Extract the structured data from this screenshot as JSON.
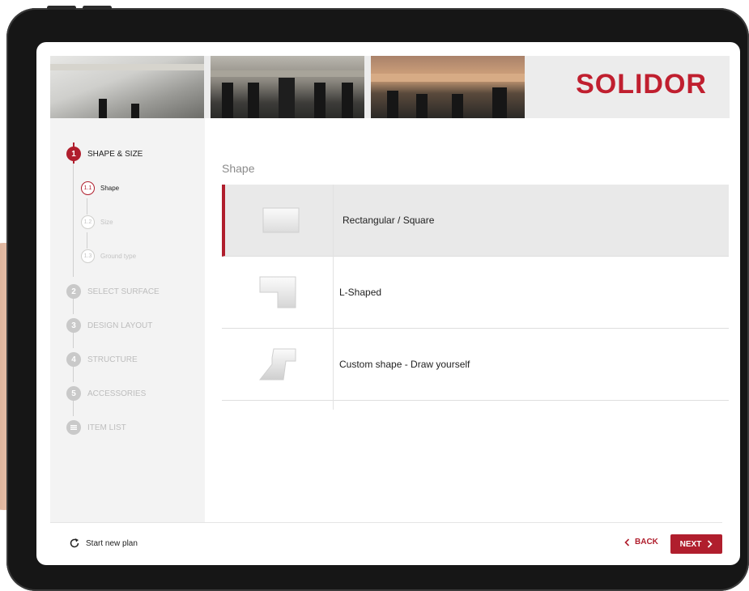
{
  "brand": {
    "logo_text": "SOLIDOR",
    "accent": "#b01e2d"
  },
  "sidebar": {
    "steps": [
      {
        "num": "1",
        "label": "SHAPE & SIZE",
        "state": "active"
      },
      {
        "num": "2",
        "label": "SELECT SURFACE",
        "state": "inactive"
      },
      {
        "num": "3",
        "label": "DESIGN LAYOUT",
        "state": "inactive"
      },
      {
        "num": "4",
        "label": "STRUCTURE",
        "state": "inactive"
      },
      {
        "num": "5",
        "label": "ACCESSORIES",
        "state": "inactive"
      },
      {
        "icon": "list-icon",
        "label": "ITEM LIST",
        "state": "inactive"
      }
    ],
    "substeps": [
      {
        "num": "1.1",
        "label": "Shape",
        "state": "active"
      },
      {
        "num": "1.2",
        "label": "Size",
        "state": "inactive"
      },
      {
        "num": "1.3",
        "label": "Ground type",
        "state": "inactive"
      }
    ]
  },
  "main": {
    "section_title": "Shape",
    "shapes": [
      {
        "label": "Rectangular / Square",
        "icon": "rectangle-shape-icon",
        "selected": true
      },
      {
        "label": "L-Shaped",
        "icon": "l-shape-icon",
        "selected": false
      },
      {
        "label": "Custom shape - Draw yourself",
        "icon": "custom-shape-icon",
        "selected": false
      }
    ]
  },
  "footer": {
    "start_new_label": "Start new plan",
    "start_new_icon": "refresh-icon",
    "back_label": "BACK",
    "next_label": "NEXT"
  }
}
